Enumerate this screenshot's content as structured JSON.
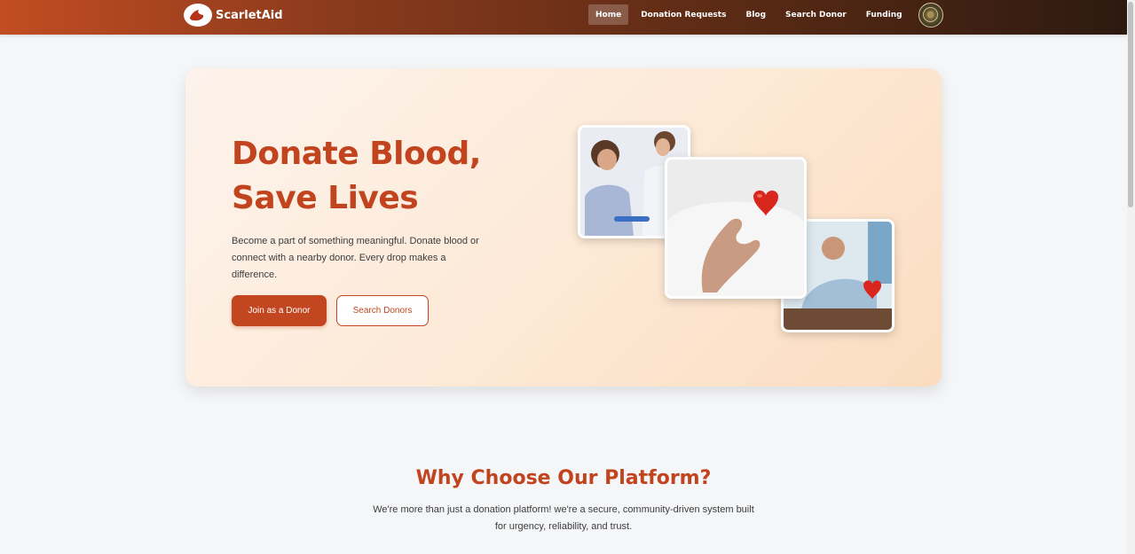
{
  "navbar": {
    "brand": "ScarletAid",
    "links": [
      {
        "label": "Home",
        "active": true
      },
      {
        "label": "Donation Requests",
        "active": false
      },
      {
        "label": "Blog",
        "active": false
      },
      {
        "label": "Search Donor",
        "active": false
      },
      {
        "label": "Funding",
        "active": false
      }
    ]
  },
  "hero": {
    "title_line1": "Donate Blood,",
    "title_line2": "Save Lives",
    "description": "Become a part of something meaningful. Donate blood or connect with a nearby donor. Every drop makes a difference.",
    "primary_button": "Join as a Donor",
    "secondary_button": "Search Donors"
  },
  "why": {
    "title": "Why Choose Our Platform?",
    "description": "We're more than just a donation platform! we're a secure, community-driven system built for urgency, reliability, and trust."
  },
  "colors": {
    "accent": "#c1441f",
    "nav_start": "#c24d22",
    "nav_end": "#2d1a10"
  }
}
